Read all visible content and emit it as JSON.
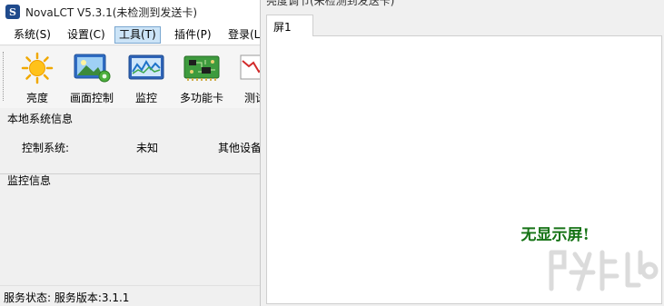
{
  "left_window": {
    "title": "NovaLCT V5.3.1(未检测到发送卡)",
    "menu": [
      {
        "label": "系统(S)"
      },
      {
        "label": "设置(C)"
      },
      {
        "label": "工具(T)",
        "active": true
      },
      {
        "label": "插件(P)"
      },
      {
        "label": "登录(L)"
      }
    ],
    "toolbar": [
      {
        "label": "亮度",
        "icon": "sun-icon"
      },
      {
        "label": "画面控制",
        "icon": "picture-gear-icon"
      },
      {
        "label": "监控",
        "icon": "monitor-chart-icon"
      },
      {
        "label": "多功能卡",
        "icon": "circuit-board-icon"
      },
      {
        "label": "测试",
        "icon": "test-chart-icon"
      }
    ],
    "local_info": {
      "title": "本地系统信息",
      "control_system_label": "控制系统:",
      "control_system_value": "未知",
      "other_device_label": "其他设备"
    },
    "monitor_info": {
      "title": "监控信息"
    },
    "status": "服务状态: 服务版本:3.1.1"
  },
  "right_window": {
    "title": "亮度调节(未检测到发送卡)",
    "tabs": [
      {
        "label": "屏1"
      }
    ],
    "message": "无显示屏!"
  },
  "colors": {
    "menu_active_bg": "#cce4f7",
    "message_green": "#167316",
    "window_bg": "#f0f0f0"
  }
}
